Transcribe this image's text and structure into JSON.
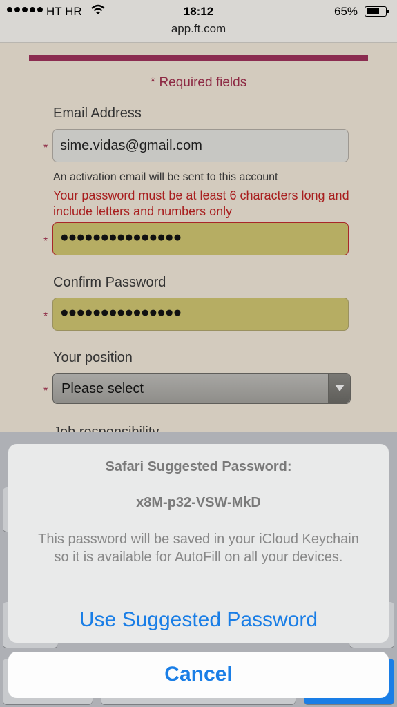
{
  "status": {
    "carrier": "HT HR",
    "time": "18:12",
    "battery": "65%"
  },
  "browser": {
    "url": "app.ft.com"
  },
  "form": {
    "required_note": "* Required fields",
    "required_star": "*",
    "email_label": "Email Address",
    "email_value": "sime.vidas@gmail.com",
    "email_hint": "An activation email will be sent to this account",
    "password_error": "Your password must be at least 6 characters long and include letters and numbers only",
    "password_value": "●●●●●●●●●●●●●●●",
    "confirm_label": "Confirm Password",
    "confirm_value": "●●●●●●●●●●●●●●●",
    "position_label": "Your position",
    "position_value": "Please select",
    "next_label": "Job responsibility"
  },
  "sheet": {
    "title": "Safari Suggested Password:",
    "password": "x8M-p32-VSW-MkD",
    "message": "This password will be saved in your iCloud Keychain so it is available for AutoFill on all your devices.",
    "use_button": "Use Suggested Password",
    "cancel_button": "Cancel"
  },
  "colors": {
    "accent": "#1a7ee6",
    "brand_bar": "#8b2c50",
    "error": "#a81e1e"
  }
}
